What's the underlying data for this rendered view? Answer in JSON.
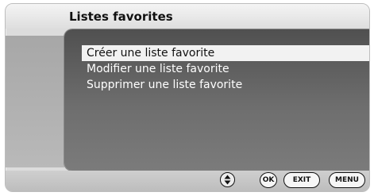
{
  "header": {
    "title": "Listes favorites"
  },
  "menu": {
    "items": [
      {
        "label": "Créer une liste favorite",
        "selected": true
      },
      {
        "label": "Modifier une liste favorite",
        "selected": false
      },
      {
        "label": "Supprimer une liste favorite",
        "selected": false
      }
    ]
  },
  "footer": {
    "nav_icon": "up-down-arrows-icon",
    "ok_label": "OK",
    "exit_label": "EXIT",
    "menu_label": "MENU"
  },
  "colors": {
    "panel_dark": "#505050",
    "panel_light": "#7b7b7b",
    "highlight": "#f2f2f2",
    "frame": "#dcdcdc"
  }
}
